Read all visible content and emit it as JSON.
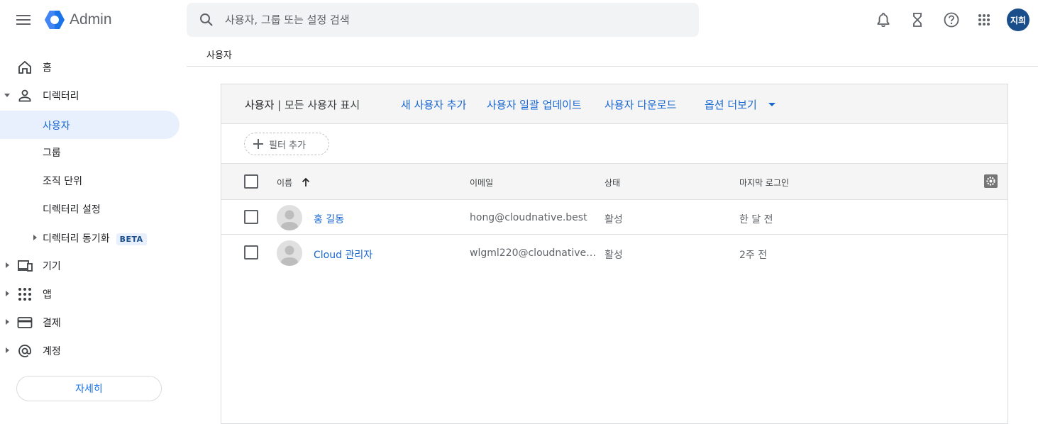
{
  "topbar": {
    "app_name": "Admin",
    "search_placeholder": "사용자, 그룹 또는 설정 검색",
    "avatar_initials": "지희",
    "icons": [
      "menu-icon",
      "bell-icon",
      "hourglass-icon",
      "help-icon",
      "apps-grid-icon"
    ]
  },
  "sidebar": {
    "items": [
      {
        "label": "홈",
        "icon": "home-icon"
      },
      {
        "label": "디렉터리",
        "icon": "person-icon",
        "expanded": true
      },
      {
        "label": "사용자",
        "active": true
      },
      {
        "label": "그룹"
      },
      {
        "label": "조직 단위"
      },
      {
        "label": "디렉터리 설정"
      },
      {
        "label": "디렉터리 동기화",
        "badge": "BETA"
      },
      {
        "label": "기기",
        "icon": "devices-icon"
      },
      {
        "label": "앱",
        "icon": "apps-icon"
      },
      {
        "label": "결제",
        "icon": "credit-card-icon"
      },
      {
        "label": "계정",
        "icon": "at-icon"
      }
    ],
    "details_button": "자세히"
  },
  "breadcrumb": "사용자",
  "card": {
    "title": "사용자",
    "subtitle": "모든 사용자 표시",
    "actions": [
      "새 사용자 추가",
      "사용자 일괄 업데이트",
      "사용자 다운로드",
      "옵션 더보기"
    ],
    "filter_label": "필터 추가",
    "columns": [
      "이름",
      "이메일",
      "상태",
      "마지막 로그인"
    ],
    "rows": [
      {
        "name": "홍 길동",
        "email": "hong@cloudnative.best",
        "status": "활성",
        "last_login": "한 달 전"
      },
      {
        "name": "Cloud 관리자",
        "email": "wlgml220@cloudnative.b...",
        "status": "활성",
        "last_login": "2주 전"
      }
    ]
  },
  "colors": {
    "accent": "#1967d2",
    "active_bg": "#e8f0fe",
    "header_bg": "#f5f5f5"
  }
}
